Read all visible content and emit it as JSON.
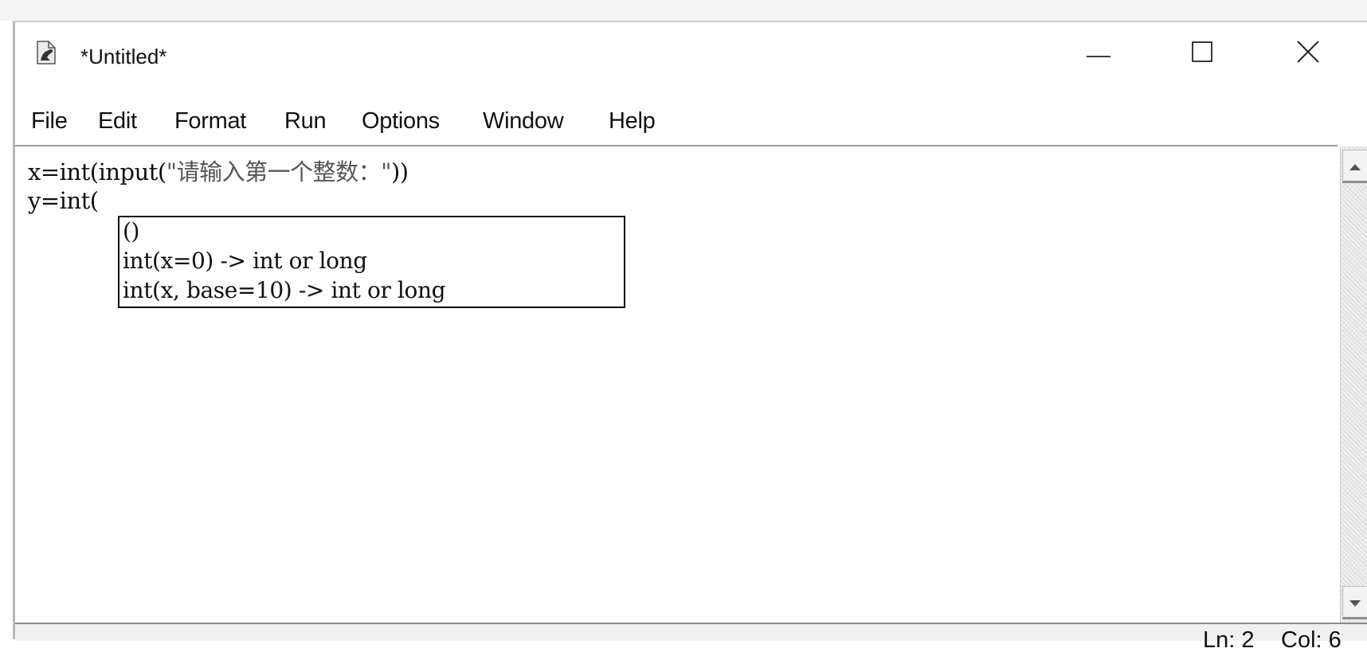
{
  "window": {
    "title": "*Untitled*",
    "icon": "idle-python-icon",
    "controls": {
      "minimize": "minimize-icon",
      "maximize": "maximize-icon",
      "close": "close-icon"
    }
  },
  "menubar": {
    "items": [
      "File",
      "Edit",
      "Format",
      "Run",
      "Options",
      "Window",
      "Help"
    ]
  },
  "editor": {
    "lines": [
      {
        "prefix": "x=int(input(",
        "string": "\"请输入第一个整数：\"",
        "suffix": "))"
      },
      {
        "prefix": "y=int(",
        "string": "",
        "suffix": ""
      }
    ],
    "calltip": {
      "lines": [
        "()",
        "int(x=0) -> int or long",
        "int(x, base=10) -> int or long"
      ]
    }
  },
  "scrollbar": {
    "up": "scroll-up-arrow-icon",
    "down": "scroll-down-arrow-icon"
  },
  "statusbar": {
    "line": "Ln: 2",
    "col": "Col: 6"
  }
}
